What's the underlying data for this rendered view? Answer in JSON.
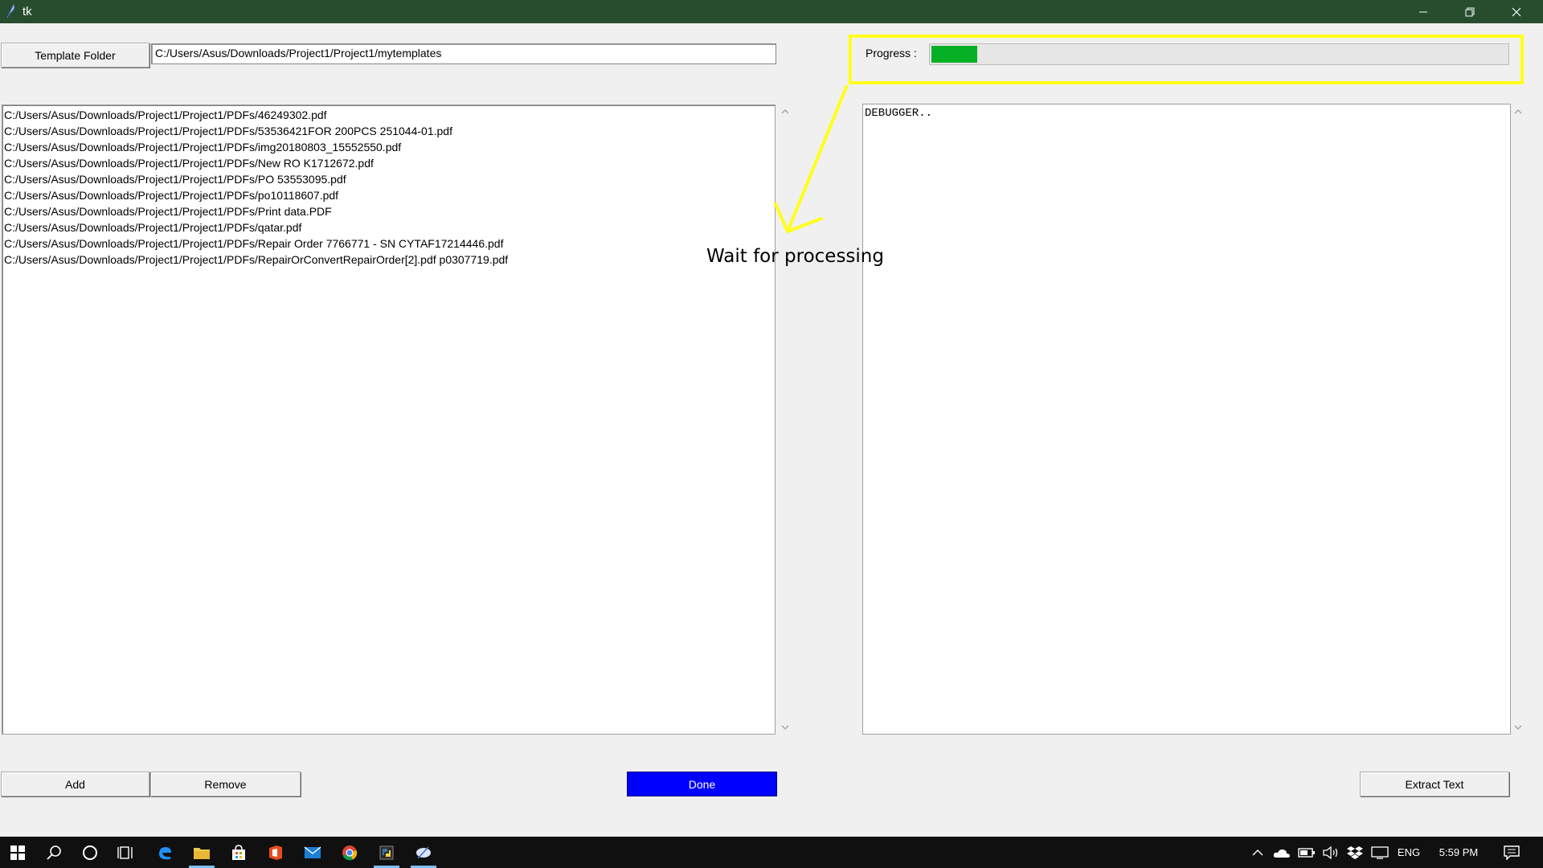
{
  "window": {
    "title": "tk"
  },
  "template": {
    "button_label": "Template Folder",
    "path_value": "C:/Users/Asus/Downloads/Project1/Project1/mytemplates"
  },
  "progress": {
    "label": "Progress :",
    "fraction": 0.08,
    "fill_color": "#06b025"
  },
  "file_list": [
    "C:/Users/Asus/Downloads/Project1/Project1/PDFs/46249302.pdf",
    "C:/Users/Asus/Downloads/Project1/Project1/PDFs/53536421FOR 200PCS 251044-01.pdf",
    "C:/Users/Asus/Downloads/Project1/Project1/PDFs/img20180803_15552550.pdf",
    "C:/Users/Asus/Downloads/Project1/Project1/PDFs/New RO K1712672.pdf",
    "C:/Users/Asus/Downloads/Project1/Project1/PDFs/PO 53553095.pdf",
    "C:/Users/Asus/Downloads/Project1/Project1/PDFs/po10118607.pdf",
    "C:/Users/Asus/Downloads/Project1/Project1/PDFs/Print data.PDF",
    "C:/Users/Asus/Downloads/Project1/Project1/PDFs/qatar.pdf",
    "C:/Users/Asus/Downloads/Project1/Project1/PDFs/Repair Order 7766771 - SN CYTAF17214446.pdf",
    "C:/Users/Asus/Downloads/Project1/Project1/PDFs/RepairOrConvertRepairOrder[2].pdf p0307719.pdf"
  ],
  "debugger": {
    "text": "DEBUGGER.."
  },
  "annotation": {
    "text": "Wait for processing",
    "color": "#ffff1a"
  },
  "buttons": {
    "add": "Add",
    "remove": "Remove",
    "done": "Done",
    "extract": "Extract Text"
  },
  "colors": {
    "titlebar": "#264d2e",
    "done_button": "#0000ff"
  },
  "taskbar": {
    "language": "ENG",
    "time": "5:59 PM",
    "pinned_icons": [
      "windows-start-icon",
      "search-icon",
      "cortana-icon",
      "task-view-icon",
      "edge-icon",
      "file-explorer-icon",
      "store-icon",
      "office-icon",
      "mail-icon",
      "chrome-icon",
      "python-icon",
      "feather-icon"
    ],
    "tray_icons": [
      "chevron-up-icon",
      "onedrive-icon",
      "battery-icon",
      "volume-icon",
      "dropbox-icon",
      "network-icon",
      "notification-icon"
    ]
  }
}
